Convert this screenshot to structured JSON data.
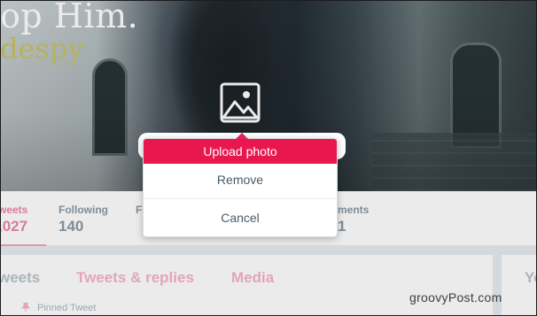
{
  "banner": {
    "text_line1": "op Him.",
    "text_line2": "despy",
    "camera_icon": "image-icon"
  },
  "profile_nav": {
    "stats": [
      {
        "label": "weets",
        "value": ",027",
        "active": true
      },
      {
        "label": "Following",
        "value": "140",
        "active": false
      },
      {
        "label": "F",
        "value": "",
        "active": false
      },
      {
        "label": "ments",
        "value": "1",
        "active": false
      }
    ]
  },
  "content": {
    "tabs": [
      "weets",
      "Tweets & replies",
      "Media"
    ],
    "side_title": "Yo",
    "pinned_label": "Pinned Tweet"
  },
  "dropdown": {
    "upload_label": "Upload photo",
    "remove_label": "Remove",
    "cancel_label": "Cancel"
  },
  "watermark": "groovyPost.com",
  "colors": {
    "accent": "#e8184f",
    "tab_pink": "#f7b3c7",
    "muted": "#8899a6"
  }
}
